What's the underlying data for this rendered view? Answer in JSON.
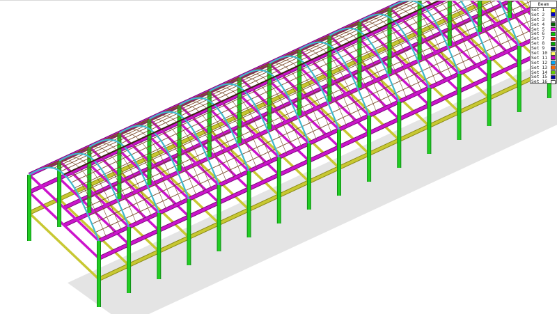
{
  "viewport": {
    "structure_colors": {
      "column": "#22cc22",
      "column_shade": "#0e8c16",
      "slab_beam": "#cc14cc",
      "slab_beam_shade": "#7a0a7a",
      "tie_beam": "#c8c832",
      "tie_beam_shade": "#8a8a14",
      "arch": "#40b8cc",
      "purlin": "#7a4a2a",
      "ridge": "#3a2212",
      "shadow": "#e4e4e4"
    }
  },
  "legend": {
    "title": "Beam",
    "items": [
      {
        "label": "Set 1",
        "color": "#ffff00"
      },
      {
        "label": "Set 2",
        "color": "#0000cc"
      },
      {
        "label": "Set 3",
        "color": "#ffffff"
      },
      {
        "label": "Set 4",
        "color": "#006400"
      },
      {
        "label": "Set 5",
        "color": "#ff00ff"
      },
      {
        "label": "Set 6",
        "color": "#00cc00"
      },
      {
        "label": "Set 7",
        "color": "#ff0000"
      },
      {
        "label": "Set 8",
        "color": "#00aa00"
      },
      {
        "label": "Set 9",
        "color": "#000080"
      },
      {
        "label": "Set 10",
        "color": "#ffff66"
      },
      {
        "label": "Set 11",
        "color": "#cc00cc"
      },
      {
        "label": "Set 12",
        "color": "#00aaff"
      },
      {
        "label": "Set 13",
        "color": "#ff6600"
      },
      {
        "label": "Set 14",
        "color": "#66cc00"
      },
      {
        "label": "Set 15",
        "color": "#0000aa"
      },
      {
        "label": "Set 16",
        "color": "#ffffff"
      }
    ]
  }
}
